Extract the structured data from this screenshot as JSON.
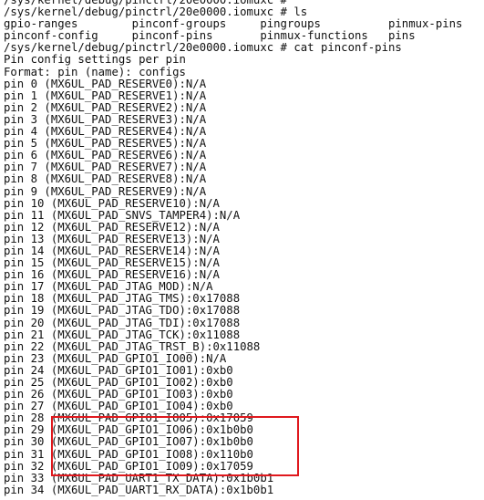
{
  "terminal": {
    "lines": [
      "/sys/kernel/debug/pinctrl/20e0000.iomuxc #",
      "/sys/kernel/debug/pinctrl/20e0000.iomuxc # ls",
      "gpio-ranges        pinconf-groups     pingroups          pinmux-pins",
      "pinconf-config     pinconf-pins       pinmux-functions   pins",
      "/sys/kernel/debug/pinctrl/20e0000.iomuxc # cat pinconf-pins",
      "Pin config settings per pin",
      "Format: pin (name): configs",
      "pin 0 (MX6UL_PAD_RESERVE0):N/A",
      "pin 1 (MX6UL_PAD_RESERVE1):N/A",
      "pin 2 (MX6UL_PAD_RESERVE2):N/A",
      "pin 3 (MX6UL_PAD_RESERVE3):N/A",
      "pin 4 (MX6UL_PAD_RESERVE4):N/A",
      "pin 5 (MX6UL_PAD_RESERVE5):N/A",
      "pin 6 (MX6UL_PAD_RESERVE6):N/A",
      "pin 7 (MX6UL_PAD_RESERVE7):N/A",
      "pin 8 (MX6UL_PAD_RESERVE8):N/A",
      "pin 9 (MX6UL_PAD_RESERVE9):N/A",
      "pin 10 (MX6UL_PAD_RESERVE10):N/A",
      "pin 11 (MX6UL_PAD_SNVS_TAMPER4):N/A",
      "pin 12 (MX6UL_PAD_RESERVE12):N/A",
      "pin 13 (MX6UL_PAD_RESERVE13):N/A",
      "pin 14 (MX6UL_PAD_RESERVE14):N/A",
      "pin 15 (MX6UL_PAD_RESERVE15):N/A",
      "pin 16 (MX6UL_PAD_RESERVE16):N/A",
      "pin 17 (MX6UL_PAD_JTAG_MOD):N/A",
      "pin 18 (MX6UL_PAD_JTAG_TMS):0x17088",
      "pin 19 (MX6UL_PAD_JTAG_TDO):0x17088",
      "pin 20 (MX6UL_PAD_JTAG_TDI):0x17088",
      "pin 21 (MX6UL_PAD_JTAG_TCK):0x11088",
      "pin 22 (MX6UL_PAD_JTAG_TRST_B):0x11088",
      "pin 23 (MX6UL_PAD_GPIO1_IO00):N/A",
      "pin 24 (MX6UL_PAD_GPIO1_IO01):0xb0",
      "pin 25 (MX6UL_PAD_GPIO1_IO02):0xb0",
      "pin 26 (MX6UL_PAD_GPIO1_IO03):0xb0",
      "pin 27 (MX6UL_PAD_GPIO1_IO04):0xb0",
      "pin 28 (MX6UL_PAD_GPIO1_IO05):0x17059",
      "pin 29 (MX6UL_PAD_GPIO1_IO06):0x1b0b0",
      "pin 30 (MX6UL_PAD_GPIO1_IO07):0x1b0b0",
      "pin 31 (MX6UL_PAD_GPIO1_IO08):0x110b0",
      "pin 32 (MX6UL_PAD_GPIO1_IO09):0x17059",
      "pin 33 (MX6UL_PAD_UART1_TX_DATA):0x1b0b1",
      "pin 34 (MX6UL_PAD_UART1_RX_DATA):0x1b0b1"
    ]
  },
  "highlight": {
    "color": "#e0191e",
    "first_line": 35,
    "last_line": 39
  }
}
